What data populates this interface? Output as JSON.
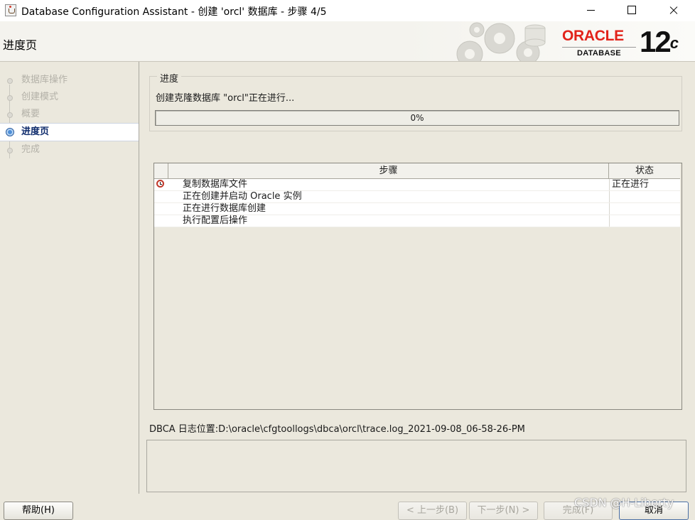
{
  "window": {
    "title": "Database Configuration Assistant - 创建 'orcl' 数据库 - 步骤 4/5"
  },
  "header": {
    "page_title": "进度页",
    "brand": "ORACLE",
    "product": "DATABASE",
    "version": "12",
    "version_suffix": "c"
  },
  "sidebar": {
    "steps": [
      {
        "label": "数据库操作",
        "state": "done"
      },
      {
        "label": "创建模式",
        "state": "done"
      },
      {
        "label": "概要",
        "state": "done"
      },
      {
        "label": "进度页",
        "state": "active"
      },
      {
        "label": "完成",
        "state": "pending"
      }
    ]
  },
  "progress": {
    "group_label": "进度",
    "status_text": "创建克隆数据库 \"orcl\"正在进行...",
    "percent": 0,
    "percent_text": "0%"
  },
  "steps_table": {
    "headers": {
      "step": "步骤",
      "state": "状态"
    },
    "rows": [
      {
        "icon": "clock-icon",
        "step": "复制数据库文件",
        "state": "正在进行"
      },
      {
        "icon": "",
        "step": "正在创建并启动 Oracle 实例",
        "state": ""
      },
      {
        "icon": "",
        "step": "正在进行数据库创建",
        "state": ""
      },
      {
        "icon": "",
        "step": "执行配置后操作",
        "state": ""
      }
    ]
  },
  "log": {
    "text": "DBCA 日志位置:D:\\oracle\\cfgtoollogs\\dbca\\orcl\\trace.log_2021-09-08_06-58-26-PM"
  },
  "footer": {
    "help": "帮助(H)",
    "back": "< 上一步(B)",
    "next": "下一步(N) >",
    "finish": "完成(F)",
    "cancel": "取消"
  },
  "watermark": "CSDN @H-Liberty",
  "colors": {
    "oracle_red": "#e2231a",
    "progress_fill": "#6d9ad6",
    "active_step_text": "#0d2a6b"
  }
}
